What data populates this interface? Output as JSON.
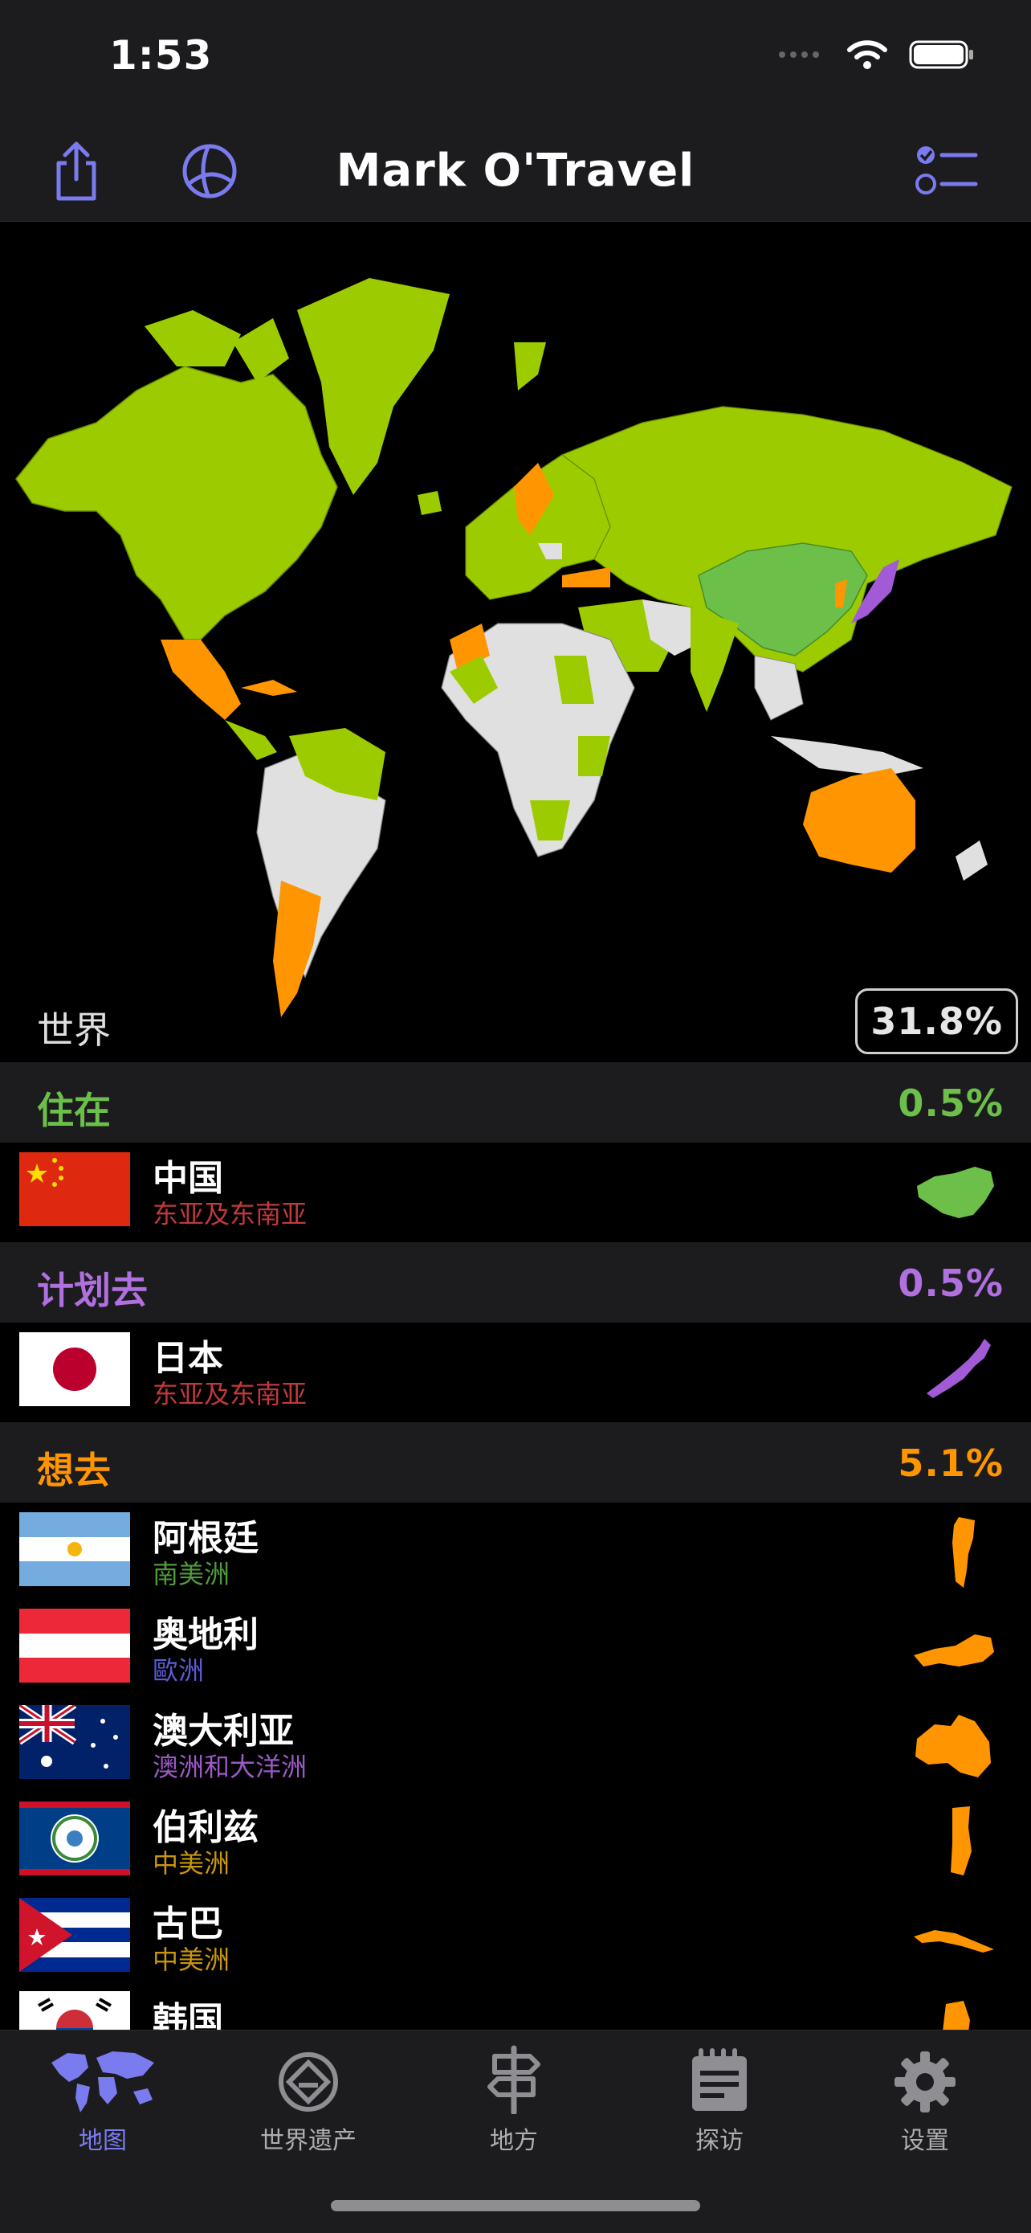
{
  "status": {
    "time": "1:53"
  },
  "nav": {
    "title": "Mark O'Travel"
  },
  "world": {
    "label": "世界",
    "percent": "31.8%"
  },
  "sections": {
    "lived": {
      "label": "住在",
      "percent": "0.5%",
      "color": "#6cc04a"
    },
    "planned": {
      "label": "计划去",
      "percent": "0.5%",
      "color": "#b070e0"
    },
    "want": {
      "label": "想去",
      "percent": "5.1%",
      "color": "#ff9500"
    }
  },
  "countries": {
    "china": {
      "name": "中国",
      "region": "东亚及东南亚"
    },
    "japan": {
      "name": "日本",
      "region": "东亚及东南亚"
    },
    "argentina": {
      "name": "阿根廷",
      "region": "南美洲"
    },
    "austria": {
      "name": "奥地利",
      "region": "歐洲"
    },
    "australia": {
      "name": "澳大利亚",
      "region": "澳洲和大洋洲"
    },
    "belize": {
      "name": "伯利兹",
      "region": "中美洲"
    },
    "cuba": {
      "name": "古巴",
      "region": "中美洲"
    },
    "korea": {
      "name": "韩国",
      "region": ""
    }
  },
  "tabs": {
    "map": "地图",
    "heritage": "世界遗产",
    "places": "地方",
    "visits": "探访",
    "settings": "设置"
  },
  "colors": {
    "visited": "#9ccc00",
    "lived": "#6cc04a",
    "planned": "#a25ad6",
    "want": "#ff9500",
    "unvisited": "#e0e0e0",
    "accent": "#7b7bf0",
    "region_east_asia": "#c0393b",
    "region_south_america": "#4f9a3a",
    "region_europe": "#5b5bd6",
    "region_oceania": "#9b59c6",
    "region_central_america": "#c8960c"
  },
  "icons": [
    "share-icon",
    "globe-icon",
    "checklist-icon",
    "world-map-icon",
    "heritage-icon",
    "signpost-icon",
    "notepad-icon",
    "gear-icon"
  ]
}
